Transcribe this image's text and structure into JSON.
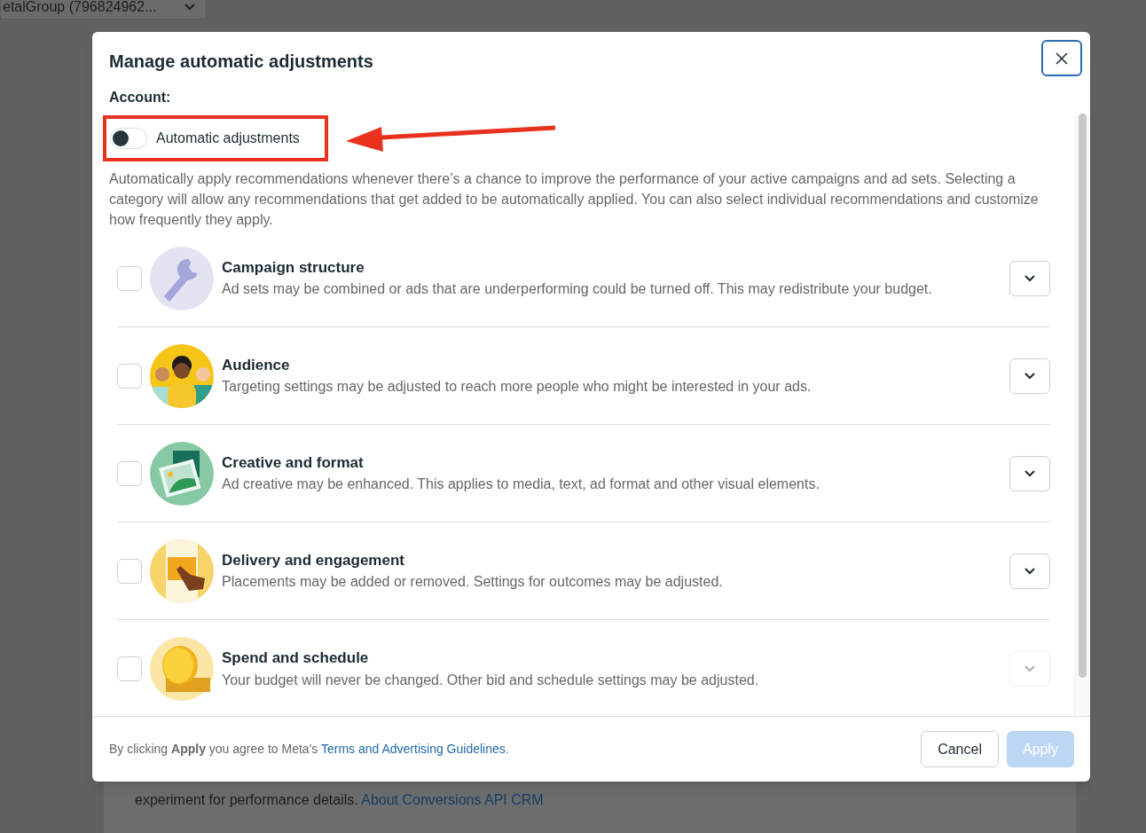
{
  "background": {
    "account_selector": "etalGroup (796824962...",
    "note": {
      "text": "experiment for performance details.",
      "link": "About Conversions API CRM"
    }
  },
  "dialog": {
    "title": "Manage automatic adjustments",
    "account_label": "Account:",
    "toggle": {
      "label": "Automatic adjustments",
      "on": false
    },
    "description": "Automatically apply recommendations whenever there’s a chance to improve the performance of your active campaigns and ad sets. Selecting a category will allow any recommendations that get added to be automatically applied. You can also select individual recommendations and customize how frequently they apply.",
    "categories": [
      {
        "title": "Campaign structure",
        "description": "Ad sets may be combined or ads that are underperforming could be turned off. This may redistribute your budget.",
        "checked": false,
        "expand_disabled": false
      },
      {
        "title": "Audience",
        "description": "Targeting settings may be adjusted to reach more people who might be interested in your ads.",
        "checked": false,
        "expand_disabled": false
      },
      {
        "title": "Creative and format",
        "description": "Ad creative may be enhanced. This applies to media, text, ad format and other visual elements.",
        "checked": false,
        "expand_disabled": false
      },
      {
        "title": "Delivery and engagement",
        "description": "Placements may be added or removed. Settings for outcomes may be adjusted.",
        "checked": false,
        "expand_disabled": false
      },
      {
        "title": "Spend and schedule",
        "description": "Your budget will never be changed. Other bid and schedule settings may be adjusted.",
        "checked": false,
        "expand_disabled": true
      }
    ],
    "footer": {
      "text": "By clicking **Apply** you agree to Meta's",
      "link": "Terms and Advertising Guidelines",
      "end": "."
    },
    "buttons": [
      {
        "label": "Cancel",
        "kind": "secondary",
        "disabled": false
      },
      {
        "label": "Apply",
        "kind": "primary",
        "disabled": true
      }
    ]
  }
}
